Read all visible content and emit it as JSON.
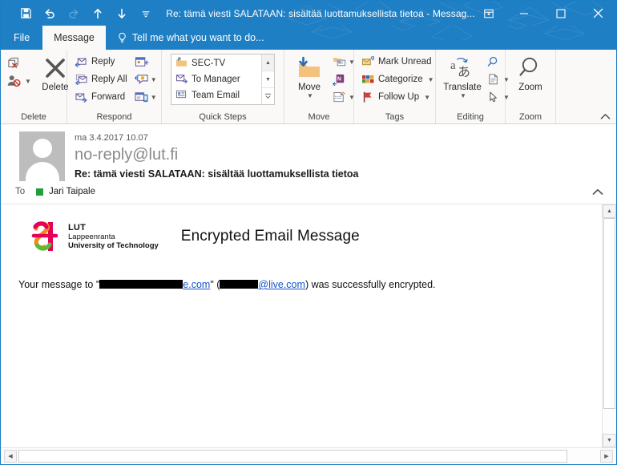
{
  "window": {
    "title": "Re: tämä viesti SALATAAN:  sisältää luottamuksellista tietoa - Messag...",
    "quick_access": [
      {
        "name": "save-icon",
        "label": "Save",
        "disabled": false
      },
      {
        "name": "undo-icon",
        "label": "Undo",
        "disabled": false
      },
      {
        "name": "redo-icon",
        "label": "Redo",
        "disabled": true
      },
      {
        "name": "previous-item-icon",
        "label": "Previous Item",
        "disabled": false
      },
      {
        "name": "next-item-icon",
        "label": "Next Item",
        "disabled": false
      },
      {
        "name": "customize-qat-icon",
        "label": "Customize Quick Access Toolbar",
        "disabled": false
      }
    ],
    "controls": [
      {
        "name": "ribbon-display-options-icon",
        "label": "Ribbon Display Options"
      },
      {
        "name": "minimize-icon",
        "label": "Minimize"
      },
      {
        "name": "maximize-icon",
        "label": "Maximize"
      },
      {
        "name": "close-icon",
        "label": "Close"
      }
    ],
    "accent_color": "#1f7fc4"
  },
  "tabs": {
    "file": "File",
    "message": "Message",
    "tellme": "Tell me what you want to do..."
  },
  "ribbon": {
    "groups": [
      {
        "label": "Delete",
        "buttons": [
          "Delete"
        ],
        "small": [
          "Ignore",
          "Junk"
        ]
      },
      {
        "label": "Respond",
        "items": [
          "Reply",
          "Reply All",
          "Forward"
        ],
        "extra": [
          "Meeting",
          "More Respond",
          "Reply with IM"
        ]
      },
      {
        "label": "Quick Steps",
        "items": [
          "SEC-TV",
          "To Manager",
          "Team Email"
        ]
      },
      {
        "label": "Move",
        "buttons": [
          "Move"
        ],
        "extra": [
          "Rules",
          "OneNote",
          "Actions"
        ]
      },
      {
        "label": "Tags",
        "items": [
          "Mark Unread",
          "Categorize",
          "Follow Up"
        ]
      },
      {
        "label": "Editing",
        "buttons": [
          "Translate"
        ],
        "extra": [
          "Find",
          "Related",
          "Select"
        ]
      },
      {
        "label": "Zoom",
        "buttons": [
          "Zoom"
        ]
      }
    ]
  },
  "message": {
    "date": "ma 3.4.2017 10.07",
    "from": "no-reply@lut.fi",
    "subject": "Re: tämä viesti SALATAAN:  sisältää luottamuksellista tietoa",
    "to_label": "To",
    "to_recipient": "Jari Taipale",
    "presence_color": "#21a03a"
  },
  "body": {
    "brand": {
      "line1": "LUT",
      "line2": "Lappeenranta",
      "line3": "University of Technology",
      "colors": {
        "crimson": "#e6005a",
        "orange": "#f08a1e",
        "green": "#5cbb35"
      }
    },
    "heading": "Encrypted Email Message",
    "paragraph": {
      "prefix": "Your message to \"",
      "link_visible_1": "e.com",
      "mid": "\" (",
      "link_visible_2": "@live.com",
      "suffix": ") was successfully encrypted."
    }
  },
  "scroll": {
    "up_arrow": "▲",
    "down_arrow": "▼",
    "left_arrow": "◀",
    "right_arrow": "▶"
  }
}
